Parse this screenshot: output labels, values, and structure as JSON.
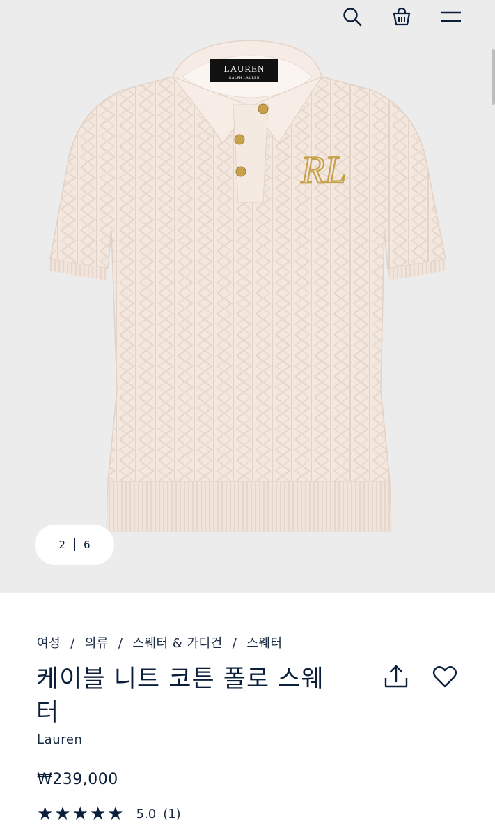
{
  "header": {
    "icons": [
      "search-icon",
      "shopping-bag-icon",
      "menu-icon"
    ]
  },
  "gallery": {
    "current": "2",
    "total": "6",
    "label_text": "LAUREN",
    "label_subtext": "RALPH LAUREN",
    "monogram_text": "RL"
  },
  "breadcrumb": {
    "items": [
      "여성",
      "의류",
      "스웨터 & 가디건",
      "스웨터"
    ],
    "separator": "/"
  },
  "product": {
    "title": "케이블 니트 코튼 폴로 스웨터",
    "brand": "Lauren",
    "price": "₩239,000",
    "rating_value": "5.0",
    "review_count": "(1)",
    "stars": 5
  },
  "colors": {
    "navy": "#0b1f3a",
    "sweater": "#f3e7de",
    "gold": "#c7a24a",
    "hero_bg": "#ececec"
  }
}
